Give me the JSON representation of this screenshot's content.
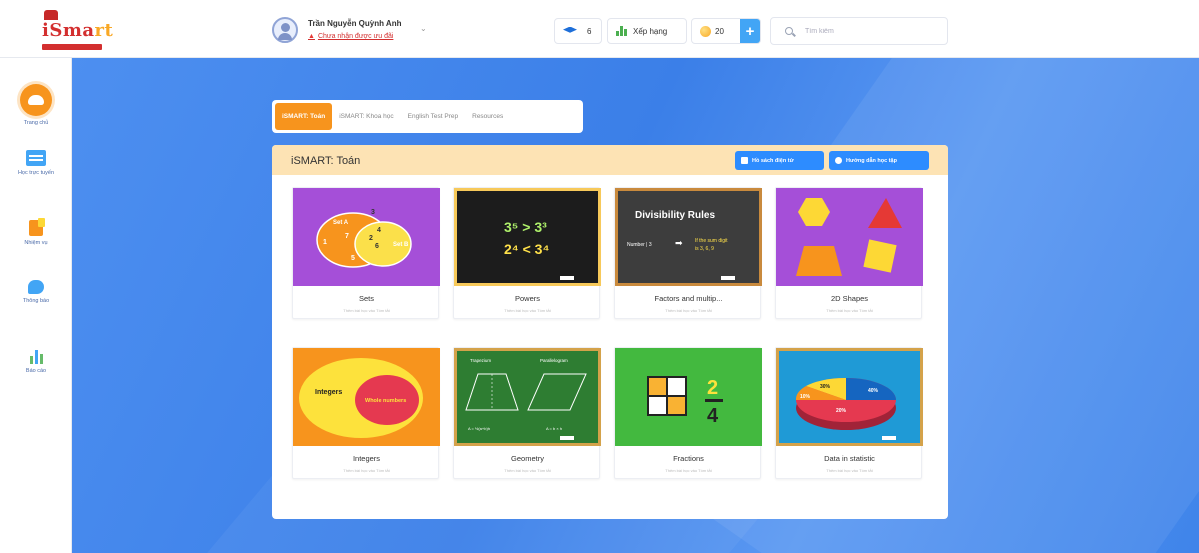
{
  "app": {
    "logo_text_a": "iSma",
    "logo_text_b": "rt"
  },
  "header": {
    "user_name": "Trần Nguyễn Quỳnh Anh",
    "user_status": "Chưa nhận được ưu đãi",
    "cap_count": "6",
    "rank_label": "Xếp hạng",
    "coin_count": "20",
    "plus_label": "+",
    "search_placeholder": "Tìm kiếm"
  },
  "sidebar": {
    "items": [
      {
        "label": "Trang chủ"
      },
      {
        "label": "Học trực tuyến"
      },
      {
        "label": "Nhiệm vụ"
      },
      {
        "label": "Thông báo"
      },
      {
        "label": "Báo cáo"
      }
    ]
  },
  "tabs": [
    {
      "label": "iSMART: Toán",
      "active": true
    },
    {
      "label": "iSMART: Khoa học",
      "active": false
    },
    {
      "label": "English Test Prep",
      "active": false
    },
    {
      "label": "Resources",
      "active": false
    }
  ],
  "panel": {
    "title": "iSMART: Toán",
    "btn_book": "Hồ sách điện tử",
    "btn_guide": "Hướng dẫn học tập"
  },
  "lessons": [
    {
      "title": "Sets",
      "subtitle": "Thêm bài học vào Tóm tắt"
    },
    {
      "title": "Powers",
      "subtitle": "Thêm bài học vào Tóm tắt"
    },
    {
      "title": "Factors and multip...",
      "subtitle": "Thêm bài học vào Tóm tắt"
    },
    {
      "title": "2D Shapes",
      "subtitle": "Thêm bài học vào Tóm tắt"
    },
    {
      "title": "Integers",
      "subtitle": "Thêm bài học vào Tóm tắt"
    },
    {
      "title": "Geometry",
      "subtitle": "Thêm bài học vào Tóm tắt"
    },
    {
      "title": "Fractions",
      "subtitle": "Thêm bài học vào Tóm tắt"
    },
    {
      "title": "Data in statistic",
      "subtitle": "Thêm bài học vào Tóm tắt"
    }
  ],
  "thumb_text": {
    "sets_a": "Set A",
    "sets_b": "Set B",
    "powers_1": "3⁵ > 3³",
    "powers_2": "2⁴ < 3⁴",
    "div_title": "Divisibility Rules",
    "div_left": "Number | 3",
    "div_right": "If the sum digit",
    "div_right2": "is 3, 6, 9",
    "int_a": "Integers",
    "int_b": "Whole numbers",
    "geo_a": "Trapezium",
    "geo_b": "Parallelogram",
    "frac_num": "2",
    "frac_den": "4",
    "data_a": "30%",
    "data_b": "40%",
    "data_c": "20%",
    "data_d": "10%"
  },
  "colors": {
    "accent_orange": "#f7941d",
    "primary_blue": "#2d8cff",
    "bg_blue": "#3b7fe8",
    "panel_header": "#fde3b4"
  }
}
